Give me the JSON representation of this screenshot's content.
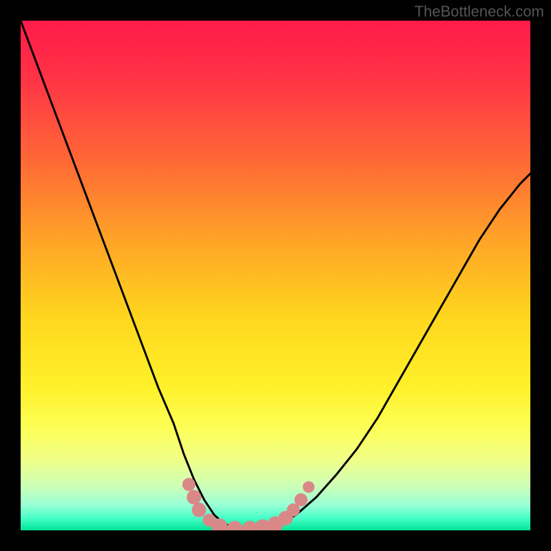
{
  "watermark": "TheBottleneck.com",
  "chart_data": {
    "type": "line",
    "title": "",
    "xlabel": "",
    "ylabel": "",
    "xlim": [
      0,
      100
    ],
    "ylim": [
      0,
      100
    ],
    "background_gradient": {
      "stops": [
        {
          "offset": 0.0,
          "color": "#ff1a4a"
        },
        {
          "offset": 0.12,
          "color": "#ff3545"
        },
        {
          "offset": 0.28,
          "color": "#ff6a35"
        },
        {
          "offset": 0.42,
          "color": "#ffa028"
        },
        {
          "offset": 0.58,
          "color": "#ffd61e"
        },
        {
          "offset": 0.72,
          "color": "#fff12a"
        },
        {
          "offset": 0.8,
          "color": "#fdff57"
        },
        {
          "offset": 0.86,
          "color": "#f0ff86"
        },
        {
          "offset": 0.91,
          "color": "#d0ffb4"
        },
        {
          "offset": 0.95,
          "color": "#9affd6"
        },
        {
          "offset": 0.975,
          "color": "#4affc8"
        },
        {
          "offset": 1.0,
          "color": "#00e596"
        }
      ]
    },
    "series": [
      {
        "name": "curve",
        "color": "#000000",
        "x": [
          0,
          3,
          6,
          9,
          12,
          15,
          18,
          21,
          24,
          27,
          30,
          32,
          34,
          36,
          38,
          40,
          43,
          46,
          50,
          54,
          58,
          62,
          66,
          70,
          74,
          78,
          82,
          86,
          90,
          94,
          98,
          100
        ],
        "y": [
          100,
          92,
          84,
          76,
          68,
          60,
          52,
          44,
          36,
          28,
          21,
          15,
          10,
          6,
          3,
          1.2,
          0.3,
          0.3,
          1.0,
          3.0,
          6.5,
          11,
          16,
          22,
          29,
          36,
          43,
          50,
          57,
          63,
          68,
          70
        ]
      }
    ],
    "markers": [
      {
        "x": 33.0,
        "y": 9.0,
        "r": 9
      },
      {
        "x": 34.0,
        "y": 6.5,
        "r": 10
      },
      {
        "x": 35.0,
        "y": 4.0,
        "r": 10
      },
      {
        "x": 37.0,
        "y": 2.0,
        "r": 9
      },
      {
        "x": 39.0,
        "y": 0.8,
        "r": 11
      },
      {
        "x": 42.0,
        "y": 0.3,
        "r": 11
      },
      {
        "x": 45.0,
        "y": 0.3,
        "r": 11
      },
      {
        "x": 47.5,
        "y": 0.6,
        "r": 11
      },
      {
        "x": 50.0,
        "y": 1.2,
        "r": 11
      },
      {
        "x": 52.0,
        "y": 2.4,
        "r": 10
      },
      {
        "x": 53.5,
        "y": 4.0,
        "r": 9
      },
      {
        "x": 55.0,
        "y": 6.0,
        "r": 9
      },
      {
        "x": 56.5,
        "y": 8.5,
        "r": 8
      }
    ],
    "marker_style": {
      "fill": "#d98888",
      "stroke": "#d98888"
    }
  }
}
